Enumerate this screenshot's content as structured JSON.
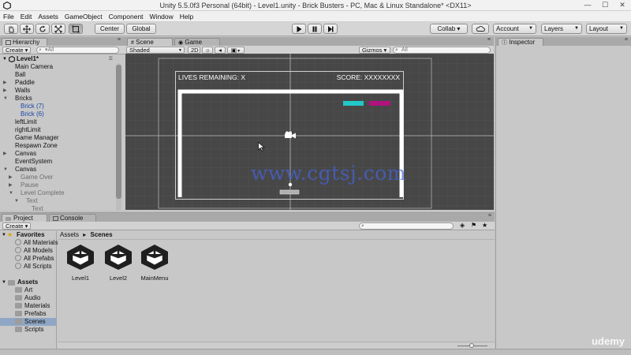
{
  "window": {
    "title": "Unity 5.5.0f3 Personal (64bit) - Level1.unity - Brick Busters - PC, Mac & Linux Standalone* <DX11>",
    "minimize": "—",
    "maximize": "☐",
    "close": "✕"
  },
  "menu": [
    "File",
    "Edit",
    "Assets",
    "GameObject",
    "Component",
    "Window",
    "Help"
  ],
  "toolbar": {
    "pivot": "Center",
    "space": "Global",
    "collab": "Collab ▾",
    "account": "Account",
    "layers": "Layers",
    "layout": "Layout"
  },
  "hierarchy": {
    "tab": "Hierarchy",
    "create": "Create ▾",
    "search_placeholder": "▾All",
    "scene": "Level1*",
    "items": [
      {
        "label": "Main Camera",
        "indent": 1,
        "arrow": "",
        "style": ""
      },
      {
        "label": "Ball",
        "indent": 1,
        "arrow": "",
        "style": ""
      },
      {
        "label": "Paddle",
        "indent": 1,
        "arrow": "▶",
        "style": ""
      },
      {
        "label": "Walls",
        "indent": 1,
        "arrow": "▶",
        "style": ""
      },
      {
        "label": "Bricks",
        "indent": 1,
        "arrow": "▼",
        "style": ""
      },
      {
        "label": "Brick (7)",
        "indent": 2,
        "arrow": "",
        "style": "blue"
      },
      {
        "label": "Brick (6)",
        "indent": 2,
        "arrow": "",
        "style": "blue"
      },
      {
        "label": "leftLimit",
        "indent": 1,
        "arrow": "",
        "style": ""
      },
      {
        "label": "rightLimit",
        "indent": 1,
        "arrow": "",
        "style": ""
      },
      {
        "label": "Game Manager",
        "indent": 1,
        "arrow": "",
        "style": ""
      },
      {
        "label": "Respawn Zone",
        "indent": 1,
        "arrow": "",
        "style": ""
      },
      {
        "label": "Canvas",
        "indent": 1,
        "arrow": "▶",
        "style": ""
      },
      {
        "label": "EventSystem",
        "indent": 1,
        "arrow": "",
        "style": ""
      },
      {
        "label": "Canvas",
        "indent": 1,
        "arrow": "▼",
        "style": ""
      },
      {
        "label": "Game Over",
        "indent": 2,
        "arrow": "▶",
        "style": "grey"
      },
      {
        "label": "Pause",
        "indent": 2,
        "arrow": "▶",
        "style": "grey"
      },
      {
        "label": "Level Complete",
        "indent": 2,
        "arrow": "▼",
        "style": "grey"
      },
      {
        "label": "Text",
        "indent": 3,
        "arrow": "▼",
        "style": "grey"
      },
      {
        "label": "Text",
        "indent": 4,
        "arrow": "",
        "style": "grey"
      }
    ]
  },
  "scene": {
    "tab": "Scene",
    "game_tab": "Game",
    "shading": "Shaded",
    "mode_2d": "2D",
    "gizmos": "Gizmos ▾",
    "search_placeholder": "All",
    "game_ui": {
      "lives": "LIVES REMAINING: X",
      "score": "SCORE: XXXXXXXX"
    },
    "watermark": "www.cgtsj.com"
  },
  "inspector": {
    "tab": "Inspector"
  },
  "project": {
    "tab": "Project",
    "console_tab": "Console",
    "create": "Create ▾",
    "breadcrumb_root": "Assets",
    "breadcrumb_sep": "▸",
    "breadcrumb_current": "Scenes",
    "favorites_label": "Favorites",
    "favorites": [
      "All Materials",
      "All Models",
      "All Prefabs",
      "All Scripts"
    ],
    "assets_label": "Assets",
    "folders": [
      "Art",
      "Audio",
      "Materials",
      "Prefabs",
      "Scenes",
      "Scripts"
    ],
    "selected_folder": "Scenes",
    "scene_files": [
      "Level1",
      "Level2",
      "MainMenu"
    ]
  },
  "colors": {
    "brick_cyan": "#22c7c7",
    "brick_magenta": "#b0127e",
    "scene_bg": "#474747",
    "selection": "#8fa6c4"
  },
  "branding": "udemy"
}
